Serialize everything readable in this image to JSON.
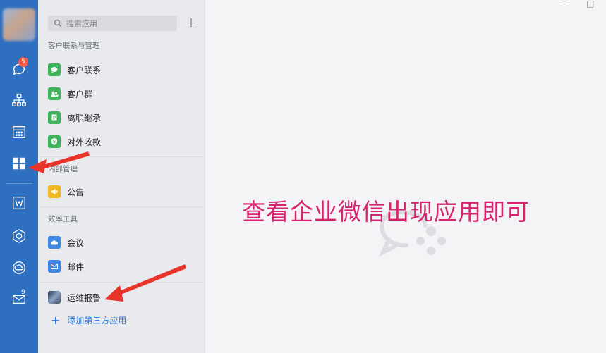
{
  "rail": {
    "chat_badge": "5",
    "mail_badge": "9",
    "icons": [
      "chat-icon",
      "org-chart-icon",
      "calendar-icon",
      "workbench-apps-icon",
      "document-icon",
      "cube-icon",
      "cloud-icon",
      "mail-icon"
    ]
  },
  "panel": {
    "search_placeholder": "搜索应用",
    "sections": [
      {
        "title": "客户联系与管理",
        "items": [
          "客户联系",
          "客户群",
          "离职继承",
          "对外收款"
        ]
      },
      {
        "title": "内部管理",
        "items": [
          "公告"
        ]
      },
      {
        "title": "效率工具",
        "items": [
          "会议",
          "邮件"
        ]
      }
    ],
    "third_party": "运维报警",
    "add_third_party": "添加第三方应用"
  },
  "main": {
    "caption": "查看企业微信出现应用即可"
  },
  "colors": {
    "rail_bg": "#2f6fbf",
    "accent_green": "#3eb35c",
    "accent_yellow": "#f2b824",
    "accent_blue": "#3d8ae6",
    "caption": "#d6246e",
    "arrow": "#e8342a"
  }
}
